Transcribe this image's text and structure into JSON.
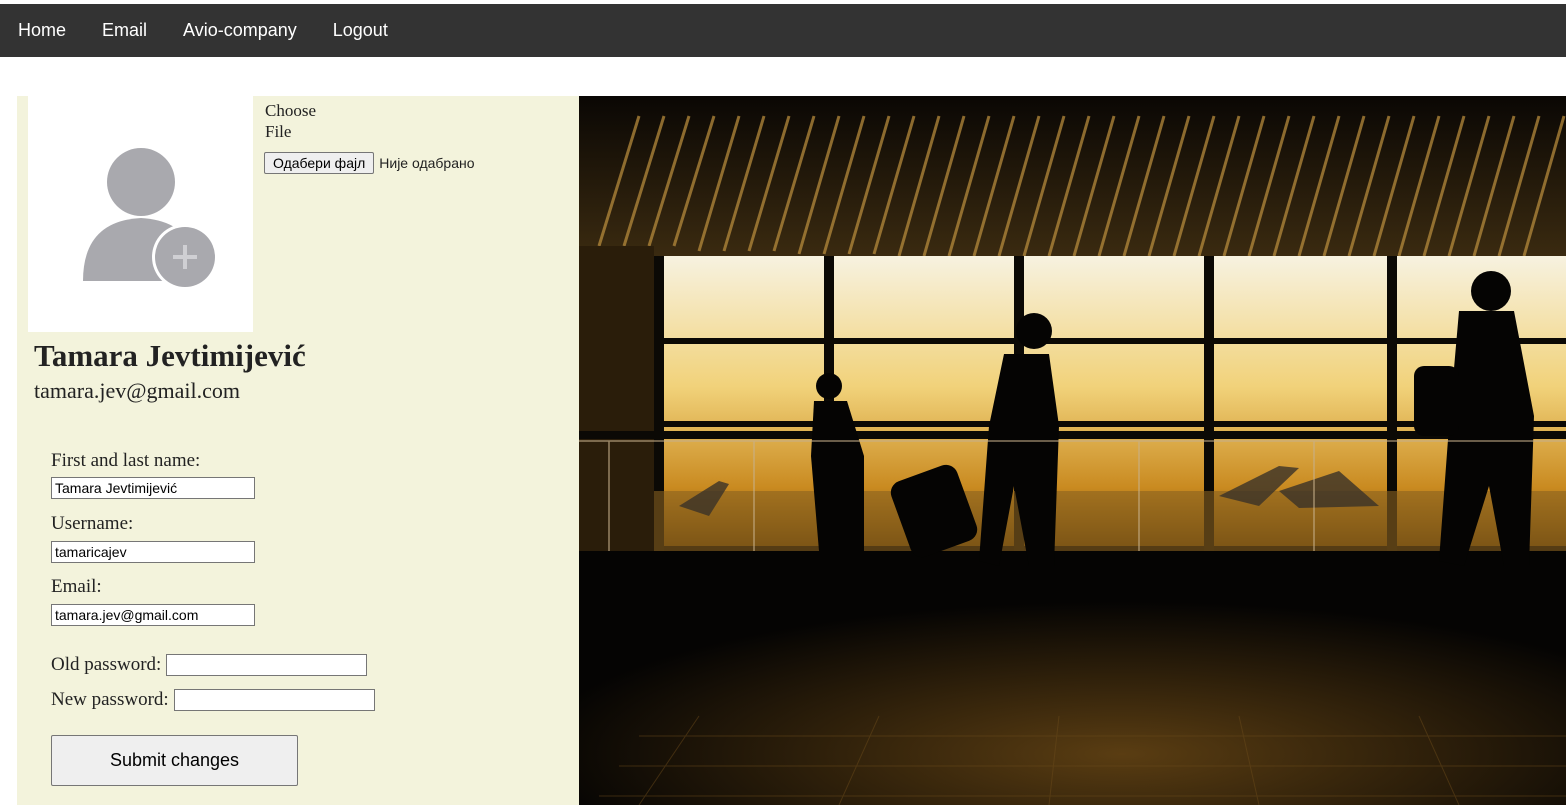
{
  "nav": {
    "items": [
      {
        "label": "Home"
      },
      {
        "label": "Email"
      },
      {
        "label": "Avio-company"
      },
      {
        "label": "Logout"
      }
    ]
  },
  "profile": {
    "avatar_icon": "add-user-avatar-icon",
    "choose_file_label": "Choose File",
    "file_button_label": "Одабери фајл",
    "file_status": "Није одабрано",
    "name": "Tamara Jevtimijević",
    "email": "tamara.jev@gmail.com"
  },
  "form": {
    "name_label": "First and last name:",
    "name_value": "Tamara Jevtimijević",
    "username_label": "Username:",
    "username_value": "tamaricajev",
    "email_label": "Email:",
    "email_value": "tamara.jev@gmail.com",
    "old_password_label": "Old password:",
    "old_password_value": "",
    "new_password_label": "New password:",
    "new_password_value": "",
    "submit_label": "Submit changes"
  },
  "colors": {
    "navbar": "#333333",
    "panel": "#f3f3dc",
    "avatar_gray": "#a9a9ae"
  }
}
